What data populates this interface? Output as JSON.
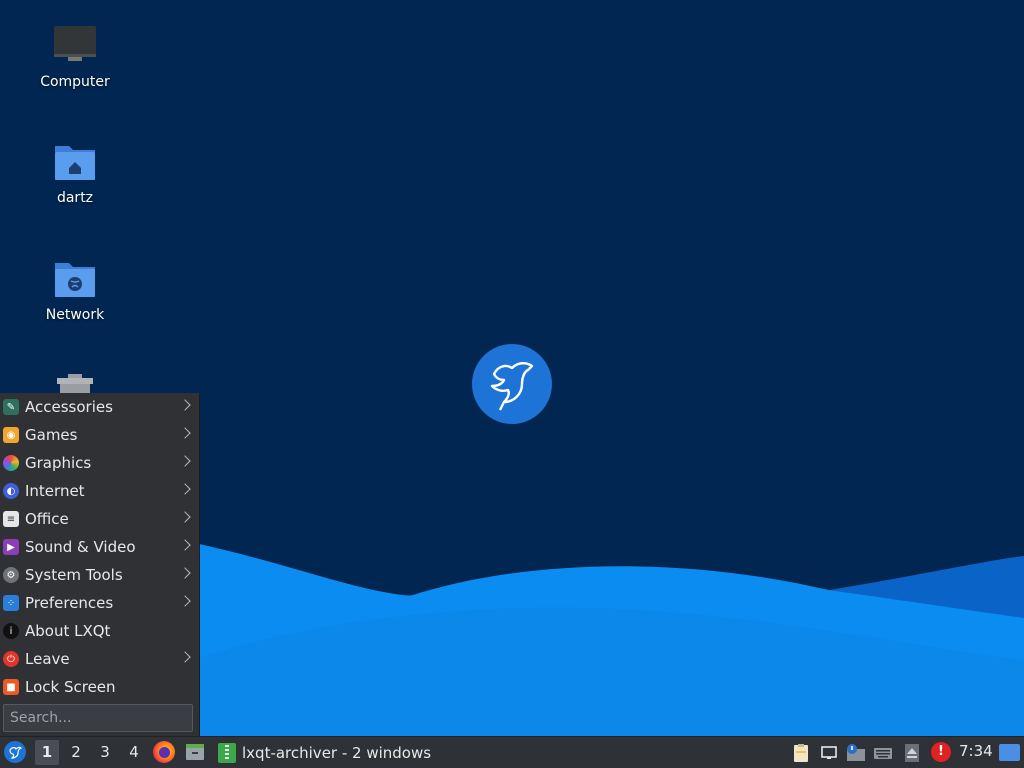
{
  "desktop": {
    "icons": [
      {
        "label": "Computer",
        "icon": "computer-icon"
      },
      {
        "label": "dartz",
        "icon": "home-folder-icon"
      },
      {
        "label": "Network",
        "icon": "network-folder-icon"
      },
      {
        "label": "",
        "icon": "trash-icon"
      }
    ],
    "wallpaper_logo": "lubuntu-bird-logo",
    "colors": {
      "background": "#002651",
      "wave_light": "#0a8cf0",
      "wave_dark": "#0a64c8",
      "logo": "#1d74d6"
    }
  },
  "start_menu": {
    "items": [
      {
        "label": "Accessories",
        "icon": "accessories-icon",
        "submenu": true
      },
      {
        "label": "Games",
        "icon": "games-icon",
        "submenu": true
      },
      {
        "label": "Graphics",
        "icon": "graphics-icon",
        "submenu": true
      },
      {
        "label": "Internet",
        "icon": "internet-icon",
        "submenu": true
      },
      {
        "label": "Office",
        "icon": "office-icon",
        "submenu": true
      },
      {
        "label": "Sound & Video",
        "icon": "sound-video-icon",
        "submenu": true
      },
      {
        "label": "System Tools",
        "icon": "system-tools-icon",
        "submenu": true
      },
      {
        "label": "Preferences",
        "icon": "preferences-icon",
        "submenu": true
      },
      {
        "label": "About LXQt",
        "icon": "info-icon",
        "submenu": false
      },
      {
        "label": "Leave",
        "icon": "power-icon",
        "submenu": true
      },
      {
        "label": "Lock Screen",
        "icon": "lock-icon",
        "submenu": false
      }
    ],
    "search_placeholder": "Search..."
  },
  "taskbar": {
    "workspaces": [
      "1",
      "2",
      "3",
      "4"
    ],
    "active_workspace": "1",
    "quicklaunch": [
      "firefox-icon",
      "file-manager-icon"
    ],
    "task_label": "lxqt-archiver - 2 windows",
    "tray_icons": [
      "clipboard-icon",
      "screen-icon",
      "update-notifier-icon",
      "keyboard-icon",
      "eject-icon",
      "alert-icon",
      "show-desktop-icon"
    ],
    "alert_glyph": "!",
    "clock": "7:34"
  }
}
